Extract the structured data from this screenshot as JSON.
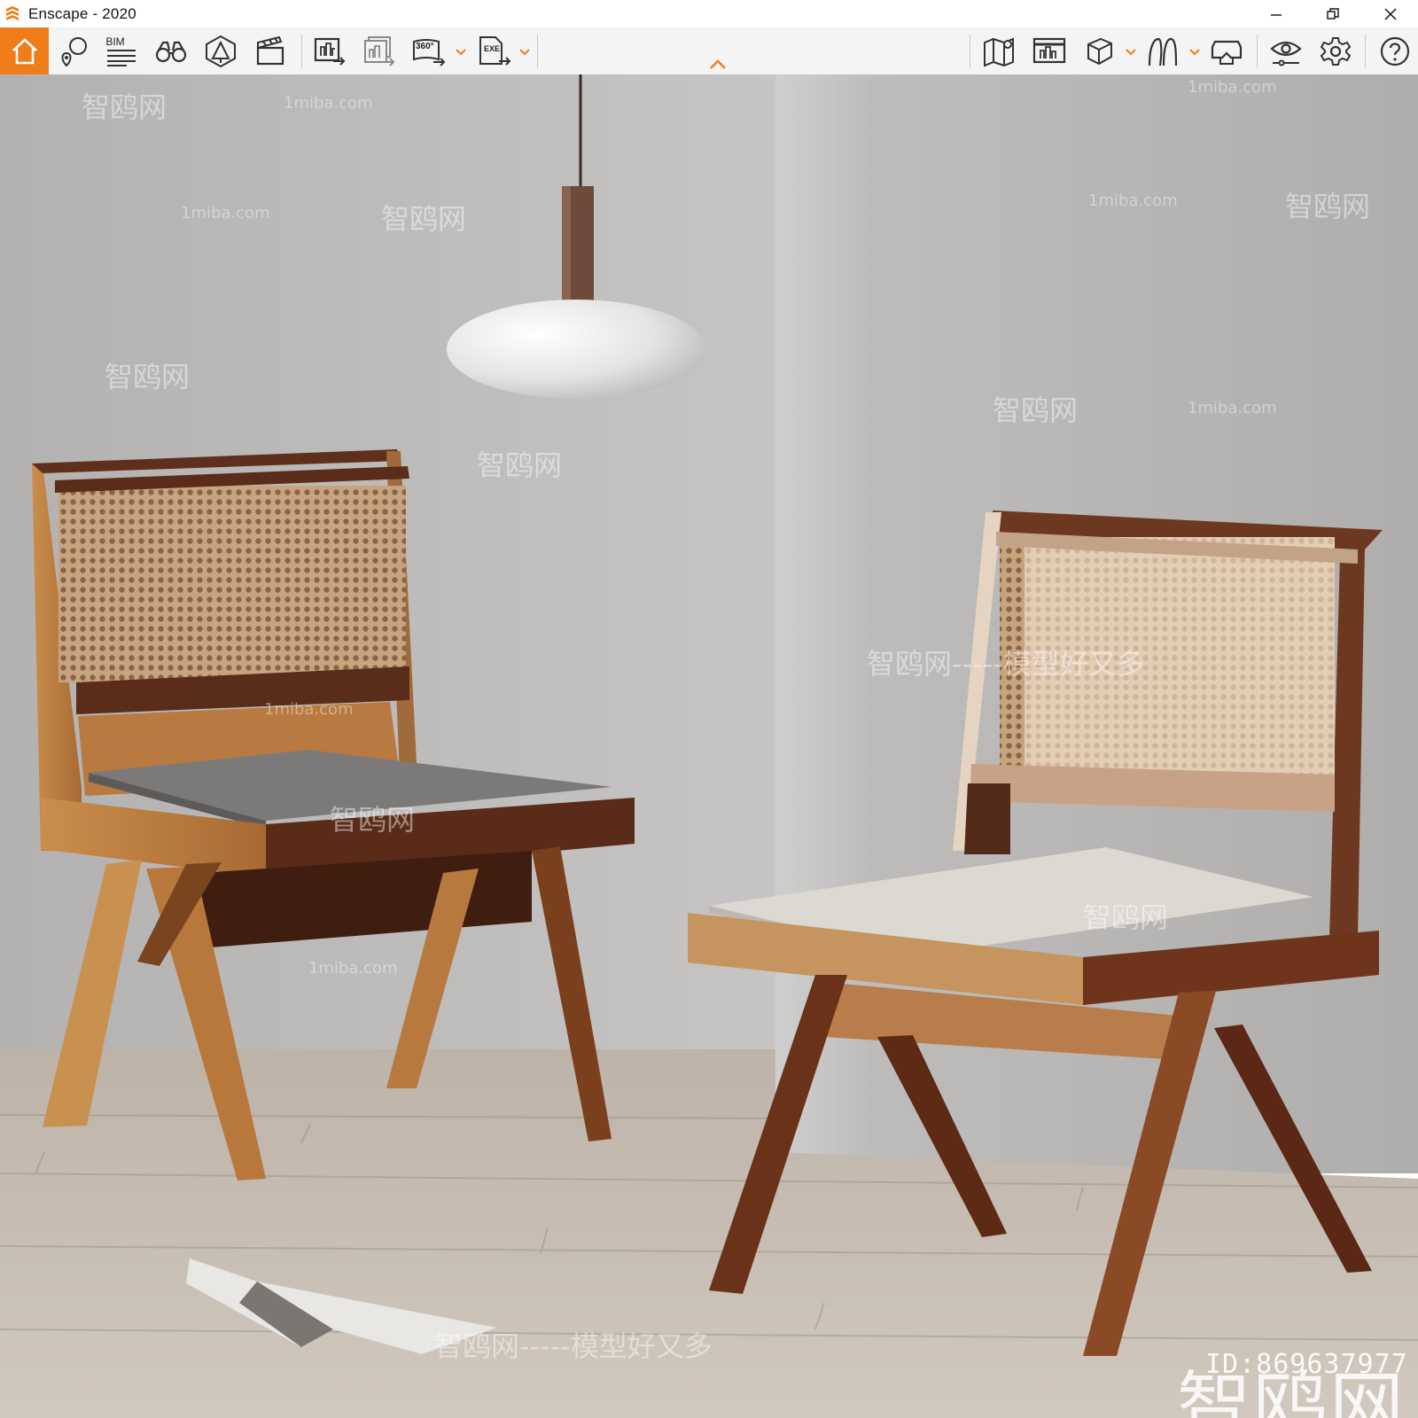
{
  "window": {
    "title": "Enscape - 2020",
    "accent_color": "#f07d1a"
  },
  "toolbar": {
    "bim_label": "BIM",
    "panorama_label": "360°",
    "exe_label": "EXE",
    "items": [
      "home-icon",
      "screenshot-location-icon",
      "bim-info-icon",
      "binoculars-icon",
      "asset-library-icon",
      "video-clapper-icon",
      "render-screenshot-icon",
      "batch-render-icon",
      "panorama-export-icon",
      "exe-export-icon",
      "map-icon",
      "views-manager-icon",
      "box-view-icon",
      "walk-fly-icon",
      "vr-headset-icon",
      "visual-settings-icon",
      "settings-gear-icon",
      "help-icon"
    ]
  },
  "watermarks": {
    "site": "1miba.com",
    "brand": "智鸥网",
    "slogan": "智鸥网-----模型好又多",
    "slogan_short": "模型好又多",
    "brand_big": "智鸥网",
    "id_text": "ID:869637977"
  }
}
